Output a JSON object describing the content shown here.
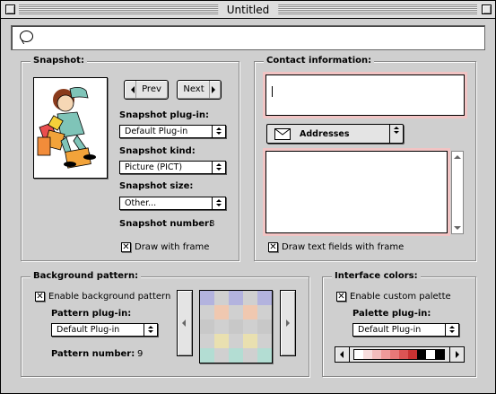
{
  "window": {
    "title": "Untitled"
  },
  "search": {
    "value": ""
  },
  "snapshot": {
    "group_label": "Snapshot:",
    "prev_label": "Prev",
    "next_label": "Next",
    "plugin_label": "Snapshot plug-in:",
    "plugin_value": "Default Plug-in",
    "kind_label": "Snapshot kind:",
    "kind_value": "Picture (PICT)",
    "size_label": "Snapshot size:",
    "size_value": "Other...",
    "number_label": "Snapshot number:",
    "number_value": "8",
    "frame_checkbox": "Draw with frame",
    "frame_checked": true
  },
  "contact": {
    "group_label": "Contact information:",
    "name_value": "",
    "addresses_label": "Addresses",
    "addresses_value": "",
    "frame_checkbox": "Draw text fields with frame",
    "frame_checked": true,
    "focus_color": "#f2c4c4"
  },
  "background": {
    "group_label": "Background pattern:",
    "enable_checkbox": "Enable background pattern",
    "enable_checked": true,
    "plugin_label": "Pattern plug-in:",
    "plugin_value": "Default Plug-in",
    "number_label": "Pattern number:",
    "number_value": "9",
    "pattern_colors": [
      "#b3b3de",
      "#ddb3c8",
      "#b3ddd3",
      "#e9e0b0",
      "#c8c8c8",
      "#f0c8b0"
    ]
  },
  "interface": {
    "group_label": "Interface colors:",
    "enable_checkbox": "Enable custom palette",
    "enable_checked": true,
    "plugin_label": "Palette plug-in:",
    "plugin_value": "Default Plug-in",
    "palette_colors": [
      "#ffffff",
      "#f7dcdc",
      "#f2bcbc",
      "#ee9a9a",
      "#e87878",
      "#dc5454",
      "#c83232",
      "#000000",
      "#ffffff",
      "#000000"
    ]
  }
}
